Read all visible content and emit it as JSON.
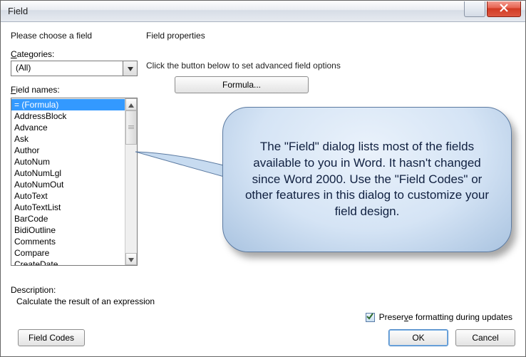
{
  "titlebar": {
    "title": "Field",
    "help_icon": "help-icon",
    "close_icon": "close-icon"
  },
  "left": {
    "heading": "Please choose a field",
    "categories_label_pre": "C",
    "categories_label_rest": "ategories:",
    "categories_value": "(All)",
    "fieldnames_label_pre": "F",
    "fieldnames_label_rest": "ield names:",
    "items": [
      "= (Formula)",
      "AddressBlock",
      "Advance",
      "Ask",
      "Author",
      "AutoNum",
      "AutoNumLgl",
      "AutoNumOut",
      "AutoText",
      "AutoTextList",
      "BarCode",
      "BidiOutline",
      "Comments",
      "Compare",
      "CreateDate"
    ],
    "selected_index": 0
  },
  "right": {
    "heading": "Field properties",
    "hint": "Click the button below to set advanced field options",
    "formula_button": "Formula...",
    "preserve_label_pre": "Preser",
    "preserve_u": "v",
    "preserve_label_post": "e formatting during updates",
    "preserve_checked": true
  },
  "description": {
    "label": "Description:",
    "text": "Calculate the result of an expression"
  },
  "footer": {
    "field_codes": "Field Codes",
    "ok": "OK",
    "cancel": "Cancel"
  },
  "callout": {
    "text": "The \"Field\" dialog lists most of the fields available to you in Word.  It hasn't changed since Word 2000.  Use the \"Field Codes\" or other features in this dialog to customize your field design."
  }
}
